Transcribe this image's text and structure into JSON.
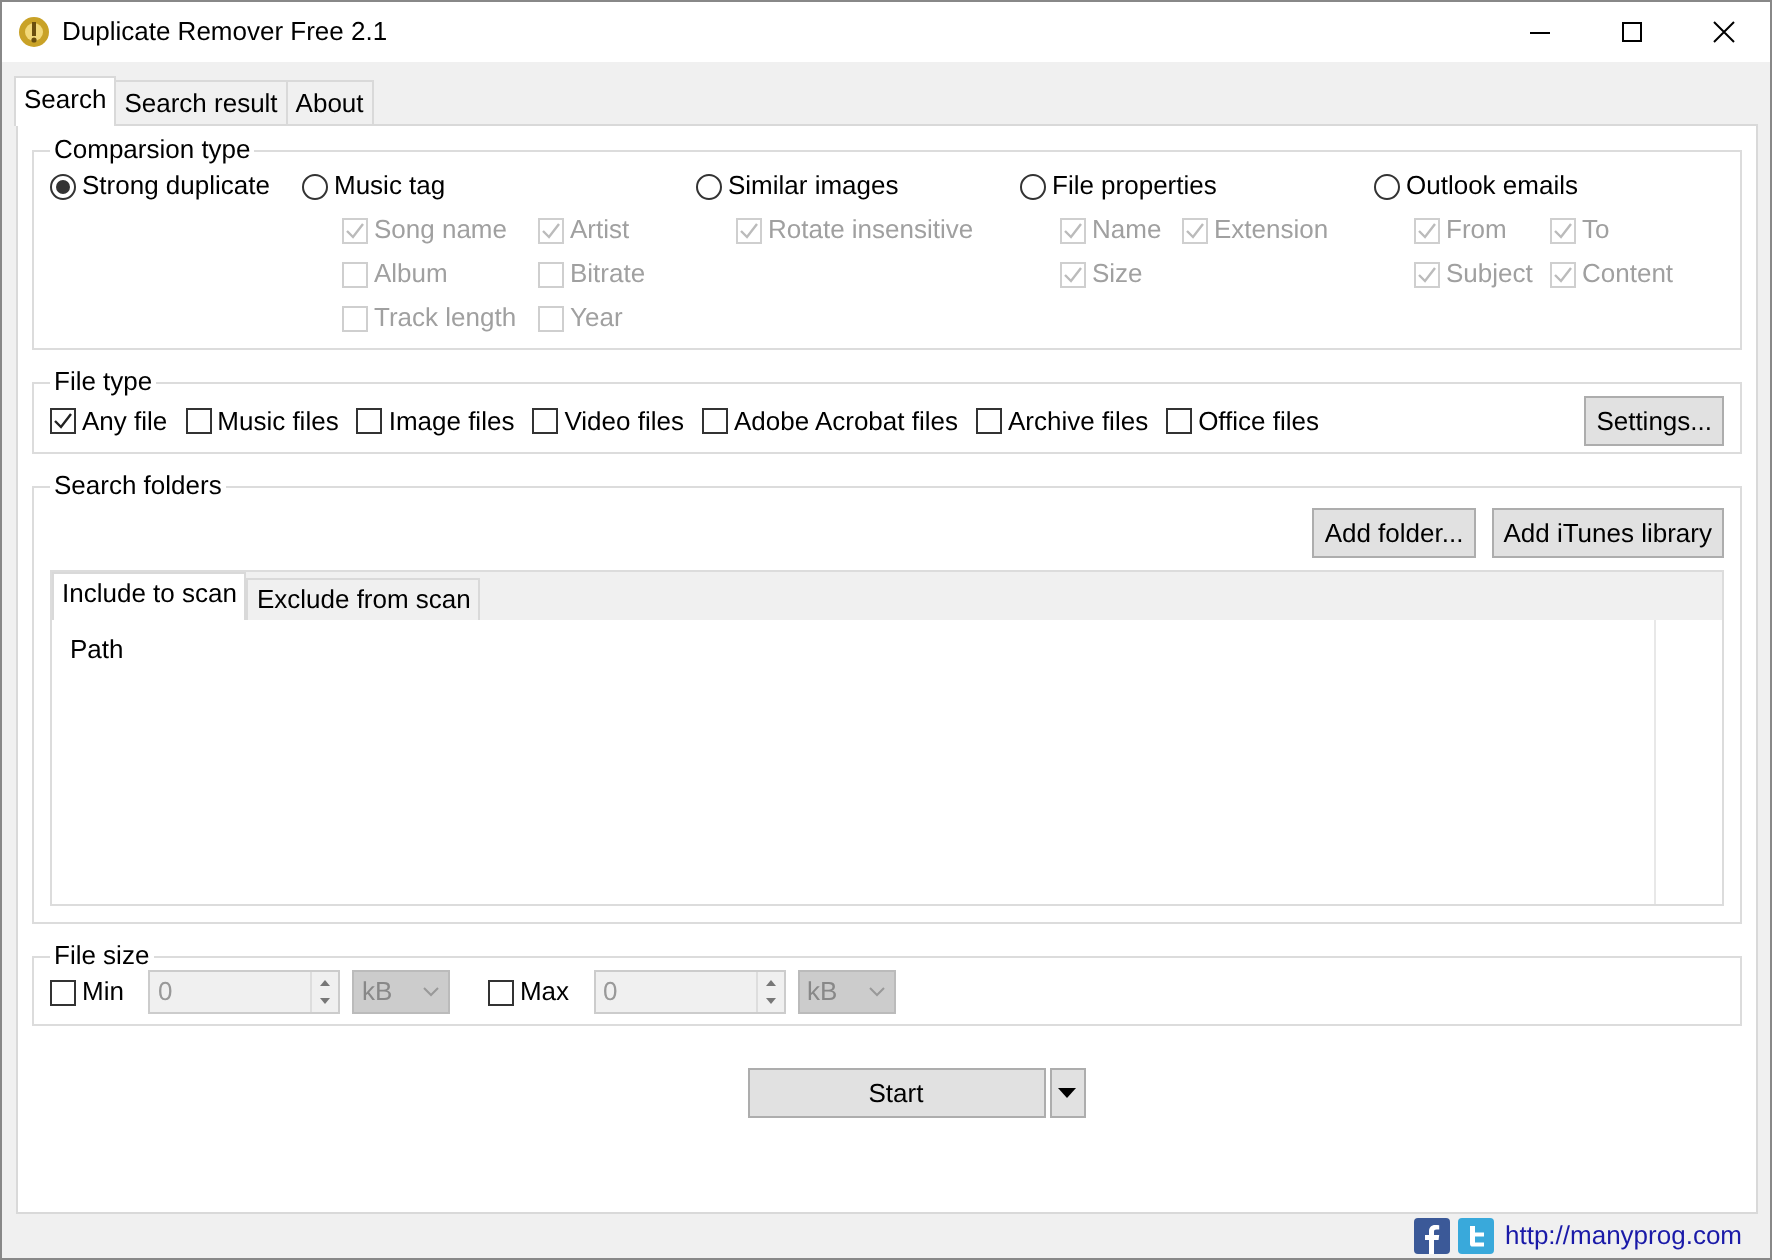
{
  "window": {
    "title": "Duplicate Remover Free 2.1"
  },
  "tabs": [
    {
      "label": "Search",
      "selected": true
    },
    {
      "label": "Search result",
      "selected": false
    },
    {
      "label": "About",
      "selected": false
    }
  ],
  "comparison_type": {
    "title": "Comparsion type",
    "options": [
      {
        "label": "Strong duplicate",
        "selected": true
      },
      {
        "label": "Music tag",
        "selected": false,
        "sub_options": [
          {
            "label": "Song name",
            "checked": true,
            "disabled": true
          },
          {
            "label": "Artist",
            "checked": true,
            "disabled": true
          },
          {
            "label": "Album",
            "checked": false,
            "disabled": true
          },
          {
            "label": "Bitrate",
            "checked": false,
            "disabled": true
          },
          {
            "label": "Track length",
            "checked": false,
            "disabled": true
          },
          {
            "label": "Year",
            "checked": false,
            "disabled": true
          }
        ]
      },
      {
        "label": "Similar images",
        "selected": false,
        "sub_options": [
          {
            "label": "Rotate insensitive",
            "checked": true,
            "disabled": true
          }
        ]
      },
      {
        "label": "File properties",
        "selected": false,
        "sub_options": [
          {
            "label": "Name",
            "checked": true,
            "disabled": true
          },
          {
            "label": "Extension",
            "checked": true,
            "disabled": true
          },
          {
            "label": "Size",
            "checked": true,
            "disabled": true
          }
        ]
      },
      {
        "label": "Outlook emails",
        "selected": false,
        "sub_options": [
          {
            "label": "From",
            "checked": true,
            "disabled": true
          },
          {
            "label": "To",
            "checked": true,
            "disabled": true
          },
          {
            "label": "Subject",
            "checked": true,
            "disabled": true
          },
          {
            "label": "Content",
            "checked": true,
            "disabled": true
          }
        ]
      }
    ]
  },
  "file_type": {
    "title": "File type",
    "options": [
      {
        "label": "Any file",
        "checked": true
      },
      {
        "label": "Music files",
        "checked": false
      },
      {
        "label": "Image files",
        "checked": false
      },
      {
        "label": "Video files",
        "checked": false
      },
      {
        "label": "Adobe Acrobat files",
        "checked": false
      },
      {
        "label": "Archive files",
        "checked": false
      },
      {
        "label": "Office files",
        "checked": false
      }
    ],
    "settings_button": "Settings..."
  },
  "search_folders": {
    "title": "Search folders",
    "buttons": [
      "Add folder...",
      "Add iTunes library"
    ],
    "tabs": [
      {
        "label": "Include to scan",
        "selected": true
      },
      {
        "label": "Exclude from scan",
        "selected": false
      }
    ],
    "column": "Path"
  },
  "file_size": {
    "title": "File size",
    "limits": [
      {
        "label": "Min",
        "checked": false,
        "value": "0",
        "unit": "kB"
      },
      {
        "label": "Max",
        "checked": false,
        "value": "0",
        "unit": "kB"
      }
    ]
  },
  "start_button": "Start",
  "footer": {
    "link": "http://manyprog.com"
  }
}
